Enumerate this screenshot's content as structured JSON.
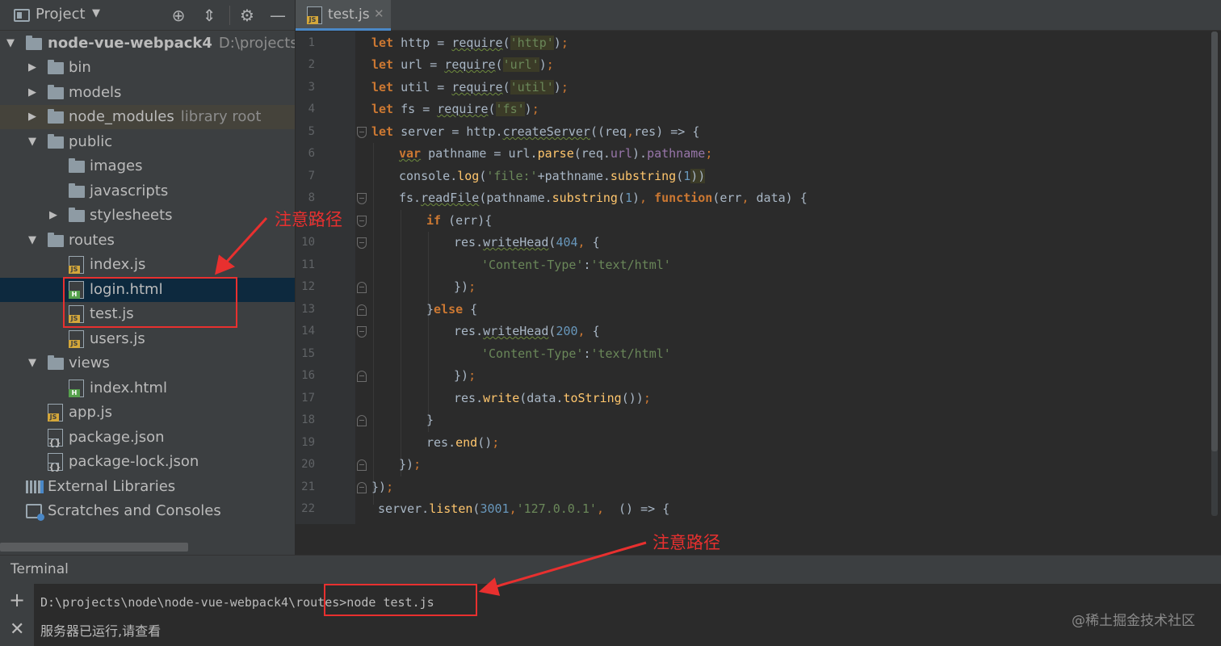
{
  "project_panel": {
    "title": "Project",
    "tree": [
      {
        "label": "node-vue-webpack4",
        "path": "D:\\projects\\no",
        "type": "project-root",
        "expanded": true
      },
      {
        "label": "bin",
        "type": "folder",
        "expanded": false
      },
      {
        "label": "models",
        "type": "folder",
        "expanded": false
      },
      {
        "label": "node_modules",
        "extra": "library root",
        "type": "folder",
        "expanded": false
      },
      {
        "label": "public",
        "type": "folder",
        "expanded": true
      },
      {
        "label": "images",
        "type": "folder"
      },
      {
        "label": "javascripts",
        "type": "folder"
      },
      {
        "label": "stylesheets",
        "type": "folder",
        "expanded": false
      },
      {
        "label": "routes",
        "type": "folder",
        "expanded": true
      },
      {
        "label": "index.js",
        "type": "js"
      },
      {
        "label": "login.html",
        "type": "html",
        "selected": true
      },
      {
        "label": "test.js",
        "type": "js"
      },
      {
        "label": "users.js",
        "type": "js"
      },
      {
        "label": "views",
        "type": "folder",
        "expanded": true
      },
      {
        "label": "index.html",
        "type": "html"
      },
      {
        "label": "app.js",
        "type": "js"
      },
      {
        "label": "package.json",
        "type": "json"
      },
      {
        "label": "package-lock.json",
        "type": "json"
      },
      {
        "label": "External Libraries",
        "type": "libraries"
      },
      {
        "label": "Scratches and Consoles",
        "type": "scratches"
      }
    ]
  },
  "editor": {
    "tab_label": "test.js",
    "file_tag": "JS",
    "line_numbers": [
      "1",
      "2",
      "3",
      "4",
      "5",
      "6",
      "7",
      "8",
      "9",
      "10",
      "11",
      "12",
      "13",
      "14",
      "15",
      "16",
      "17",
      "18",
      "19",
      "20",
      "21",
      "22"
    ],
    "code": {
      "l1_kw": "let",
      "l1_rest": " http = ",
      "l1_fn": "require",
      "l1_open": "(",
      "l1_str": "'http'",
      "l1_close": ")",
      "l1_semi": ";",
      "l2_kw": "let",
      "l2_rest": " url = ",
      "l2_fn": "require",
      "l2_open": "(",
      "l2_str": "'url'",
      "l2_close": ")",
      "l2_semi": ";",
      "l3_kw": "let",
      "l3_rest": " util = ",
      "l3_fn": "require",
      "l3_open": "(",
      "l3_str": "'util'",
      "l3_close": ")",
      "l3_semi": ";",
      "l4_kw": "let",
      "l4_rest": " fs = ",
      "l4_fn": "require",
      "l4_open": "(",
      "l4_str": "'fs'",
      "l4_close": ")",
      "l4_semi": ";",
      "l5_kw": "let",
      "l5_a": " server = http.",
      "l5_fn": "createServer",
      "l5_b": "((req",
      "l5_comma": ",",
      "l5_c": "res) => {",
      "l6_kw": "var",
      "l6_a": " pathname = url.",
      "l6_fn": "parse",
      "l6_b": "(req.",
      "l6_prop1": "url",
      "l6_c": ").",
      "l6_prop2": "pathname",
      "l6_semi": ";",
      "l7_a": "console.",
      "l7_fn": "log",
      "l7_b": "(",
      "l7_str": "'file:'",
      "l7_c": "+pathname.",
      "l7_fn2": "substring",
      "l7_d": "(",
      "l7_num": "1",
      "l7_e": "))",
      "l8_a": "fs.",
      "l8_fn": "readFile",
      "l8_b": "(pathname.",
      "l8_fn2": "substring",
      "l8_c": "(",
      "l8_num": "1",
      "l8_d": ")",
      "l8_comma": ",",
      "l8_kw": " function",
      "l8_e": "(err",
      "l8_comma2": ",",
      "l8_f": " data) {",
      "l9_kw": "if",
      "l9_a": " (err){",
      "l10_a": "res.",
      "l10_fn": "writeHead",
      "l10_b": "(",
      "l10_num": "404",
      "l10_comma": ",",
      "l10_c": " {",
      "l11_str1": "'Content-Type'",
      "l11_a": ":",
      "l11_str2": "'text/html'",
      "l12_a": "})",
      "l12_semi": ";",
      "l13_a": "}",
      "l13_kw": "else",
      "l13_b": " {",
      "l14_a": "res.",
      "l14_fn": "writeHead",
      "l14_b": "(",
      "l14_num": "200",
      "l14_comma": ",",
      "l14_c": " {",
      "l15_str1": "'Content-Type'",
      "l15_a": ":",
      "l15_str2": "'text/html'",
      "l16_a": "})",
      "l16_semi": ";",
      "l17_a": "res.",
      "l17_fn": "write",
      "l17_b": "(data.",
      "l17_fn2": "toString",
      "l17_c": "())",
      "l17_semi": ";",
      "l18_a": "}",
      "l19_a": "res.",
      "l19_fn": "end",
      "l19_b": "()",
      "l19_semi": ";",
      "l20_a": "})",
      "l20_semi": ";",
      "l21_a": "})",
      "l21_semi": ";",
      "l22_a": "server.",
      "l22_fn": "listen",
      "l22_b": "(",
      "l22_num": "3001",
      "l22_comma": ",",
      "l22_str": "'127.0.0.1'",
      "l22_comma2": ",",
      "l22_c": "  () => {"
    }
  },
  "terminal": {
    "title": "Terminal",
    "prompt_path": "D:\\projects\\node\\node-vue-webpack4\\routes>",
    "command": "node test.js",
    "output": "服务器已运行,请查看"
  },
  "annotations": {
    "note_1": "注意路径",
    "note_2": "注意路径",
    "watermark": "@稀土掘金技术社区",
    "color": "#e8302f"
  }
}
